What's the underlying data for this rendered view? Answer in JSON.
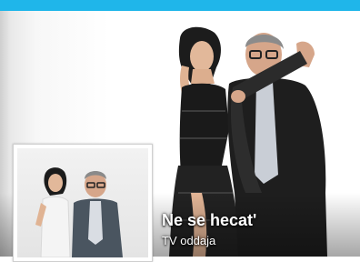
{
  "header": {
    "accent_color": "#1fb6ea"
  },
  "page": {
    "title": "Ne se hecat'",
    "category": "TV oddaja"
  },
  "images": {
    "cover": "cover-photo-two-people",
    "profile": "profile-photo-two-people"
  }
}
